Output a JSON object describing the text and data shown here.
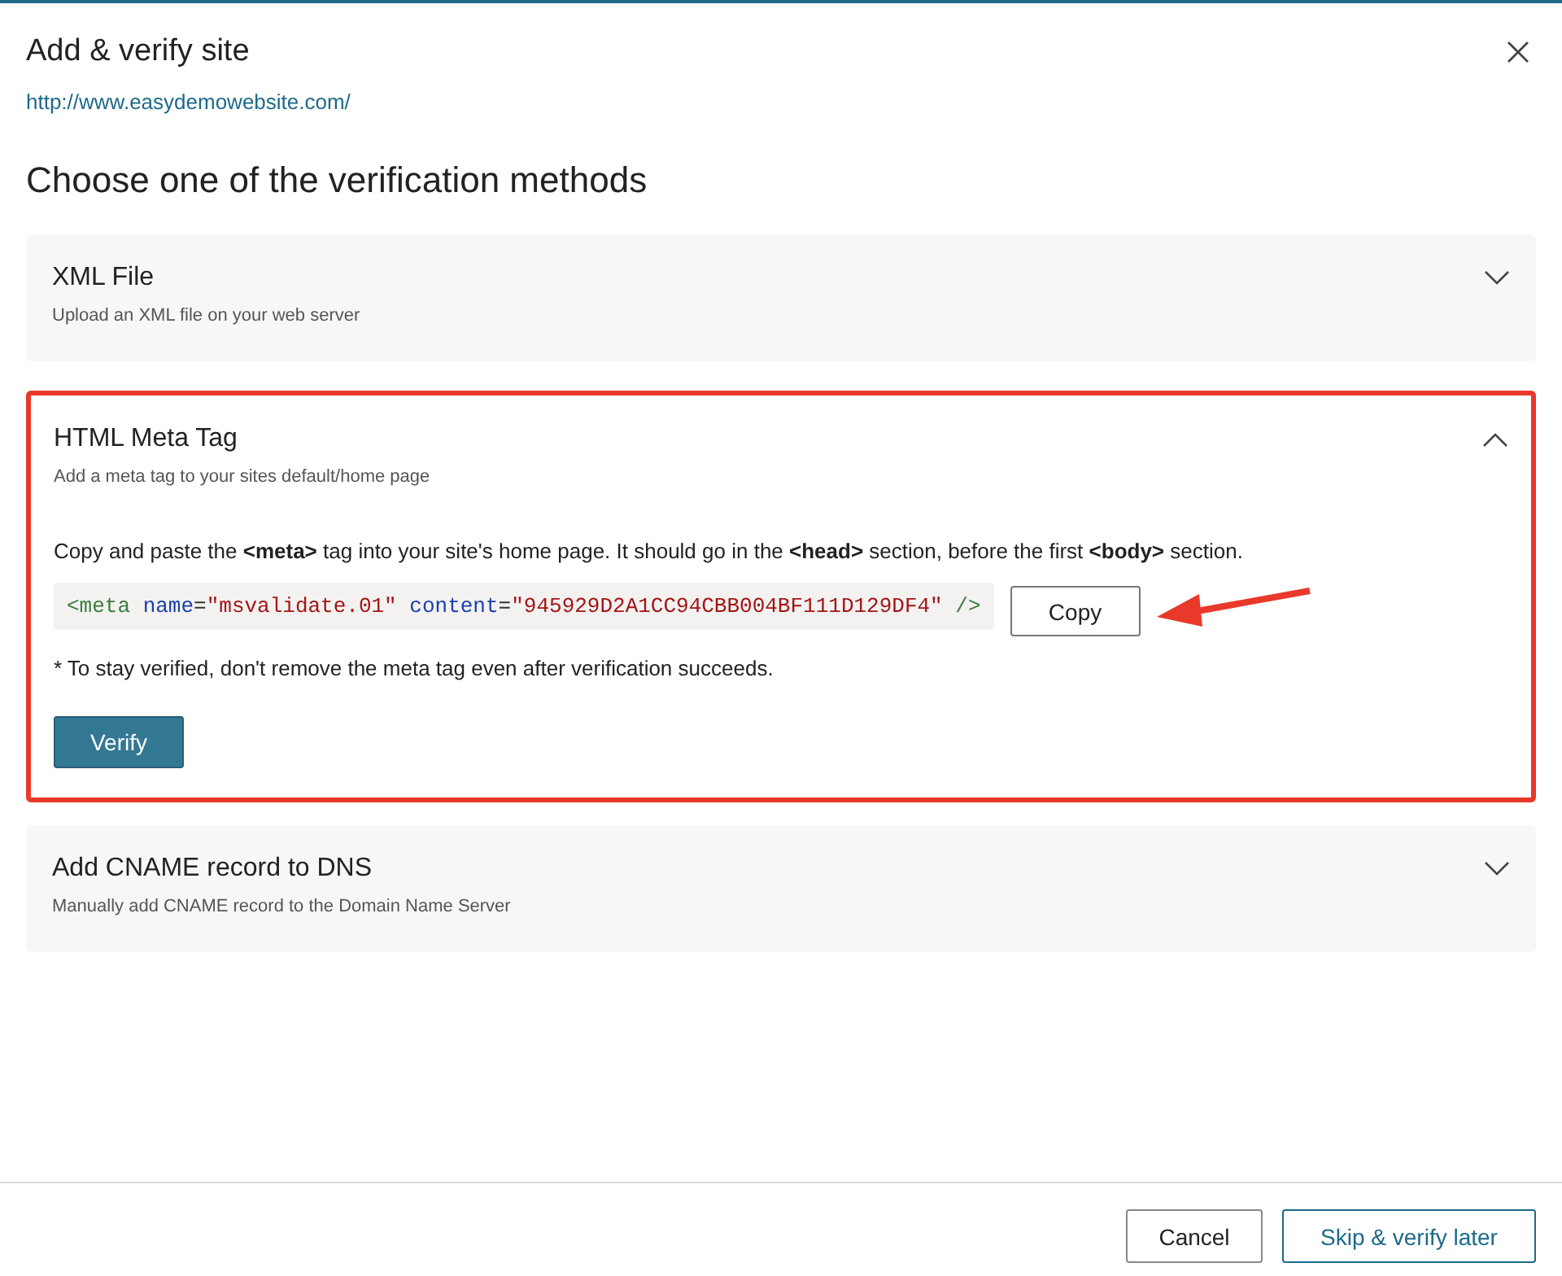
{
  "dialog": {
    "title": "Add & verify site",
    "site_url": "http://www.easydemowebsite.com/",
    "heading": "Choose one of the verification methods"
  },
  "methods": [
    {
      "title": "XML File",
      "subtitle": "Upload an XML file on your web server",
      "expanded": false,
      "highlighted": false
    },
    {
      "title": "HTML Meta Tag",
      "subtitle": "Add a meta tag to your sites default/home page",
      "expanded": true,
      "highlighted": true,
      "instructions": "Copy and paste the **<meta>** tag into your site's home page. It should go in the **<head>** section, before the first **<body>** section.",
      "code": [
        {
          "text": "<meta",
          "kind": "tag"
        },
        {
          "text": " name",
          "kind": "attr"
        },
        {
          "text": "=",
          "kind": "punct"
        },
        {
          "text": "\"msvalidate.01\"",
          "kind": "value"
        },
        {
          "text": " content",
          "kind": "attr"
        },
        {
          "text": "=",
          "kind": "punct"
        },
        {
          "text": "\"945929D2A1CC94CBB004BF111D129DF4\"",
          "kind": "value"
        },
        {
          "text": " />",
          "kind": "tag"
        }
      ],
      "copy_button": "Copy",
      "note": "* To stay verified, don't remove the meta tag even after verification succeeds.",
      "verify_button": "Verify"
    },
    {
      "title": "Add CNAME record to DNS",
      "subtitle": "Manually add CNAME record to the Domain Name Server",
      "expanded": false,
      "highlighted": false
    }
  ],
  "footer": {
    "buttons": [
      {
        "label": "Cancel",
        "kind": "secondary"
      },
      {
        "label": "Skip & verify later",
        "kind": "primary"
      }
    ]
  }
}
